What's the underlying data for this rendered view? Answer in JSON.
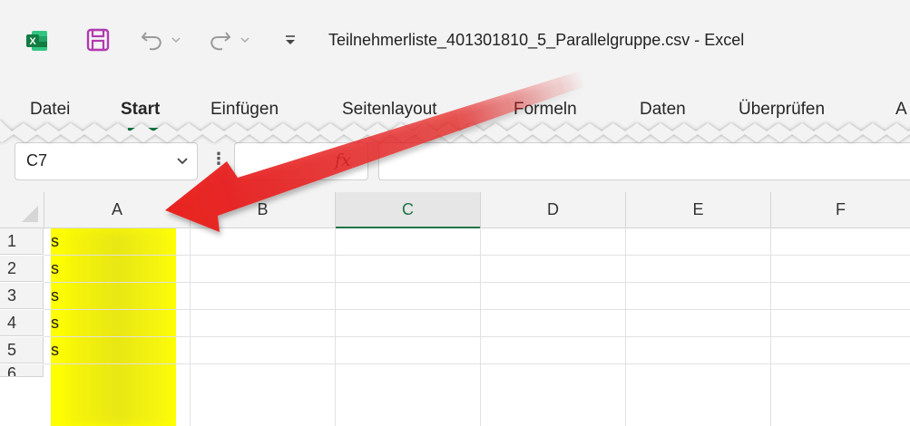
{
  "window": {
    "title": "Teilnehmerliste_401301810_5_Parallelgruppe.csv  -  Excel"
  },
  "ribbon": {
    "tabs": [
      {
        "label": "Datei"
      },
      {
        "label": "Start",
        "active": true
      },
      {
        "label": "Einfügen"
      },
      {
        "label": "Seitenlayout"
      },
      {
        "label": "Formeln"
      },
      {
        "label": "Daten"
      },
      {
        "label": "Überprüfen"
      },
      {
        "label": "A"
      }
    ]
  },
  "formula_bar": {
    "name_box": "C7",
    "more_label": "⋮",
    "fx_label": "fx",
    "formula": ""
  },
  "grid": {
    "columns": [
      "A",
      "B",
      "C",
      "D",
      "E",
      "F"
    ],
    "selected_column": "C",
    "rows": [
      "1",
      "2",
      "3",
      "4",
      "5",
      "6"
    ],
    "cells_a": [
      "s",
      "s",
      "s",
      "s",
      "s"
    ]
  },
  "colors": {
    "highlight": "#ffff00",
    "arrow": "#e8201f",
    "excel_green": "#217346",
    "save_purple": "#b23ab0"
  },
  "icons": [
    "excel-logo-icon",
    "save-icon",
    "undo-icon",
    "redo-icon",
    "chevron-down-icon",
    "customize-qat-icon",
    "fx-icon"
  ]
}
